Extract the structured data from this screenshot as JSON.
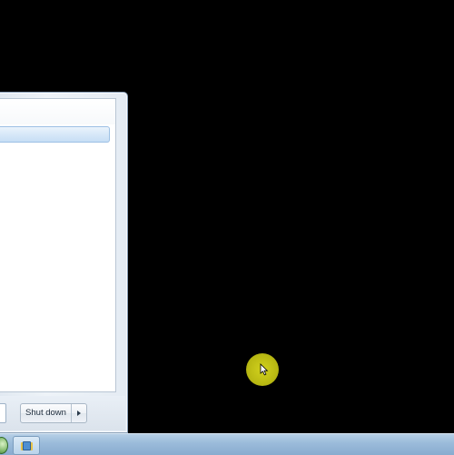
{
  "start_menu": {
    "shutdown_label": "Shut down"
  },
  "taskbar": {
    "start_orb_icon": "windows-orb-icon",
    "pinned_app_icon": "windows-explorer-icon"
  },
  "cursor": {
    "highlight_color": "#c8c818"
  }
}
